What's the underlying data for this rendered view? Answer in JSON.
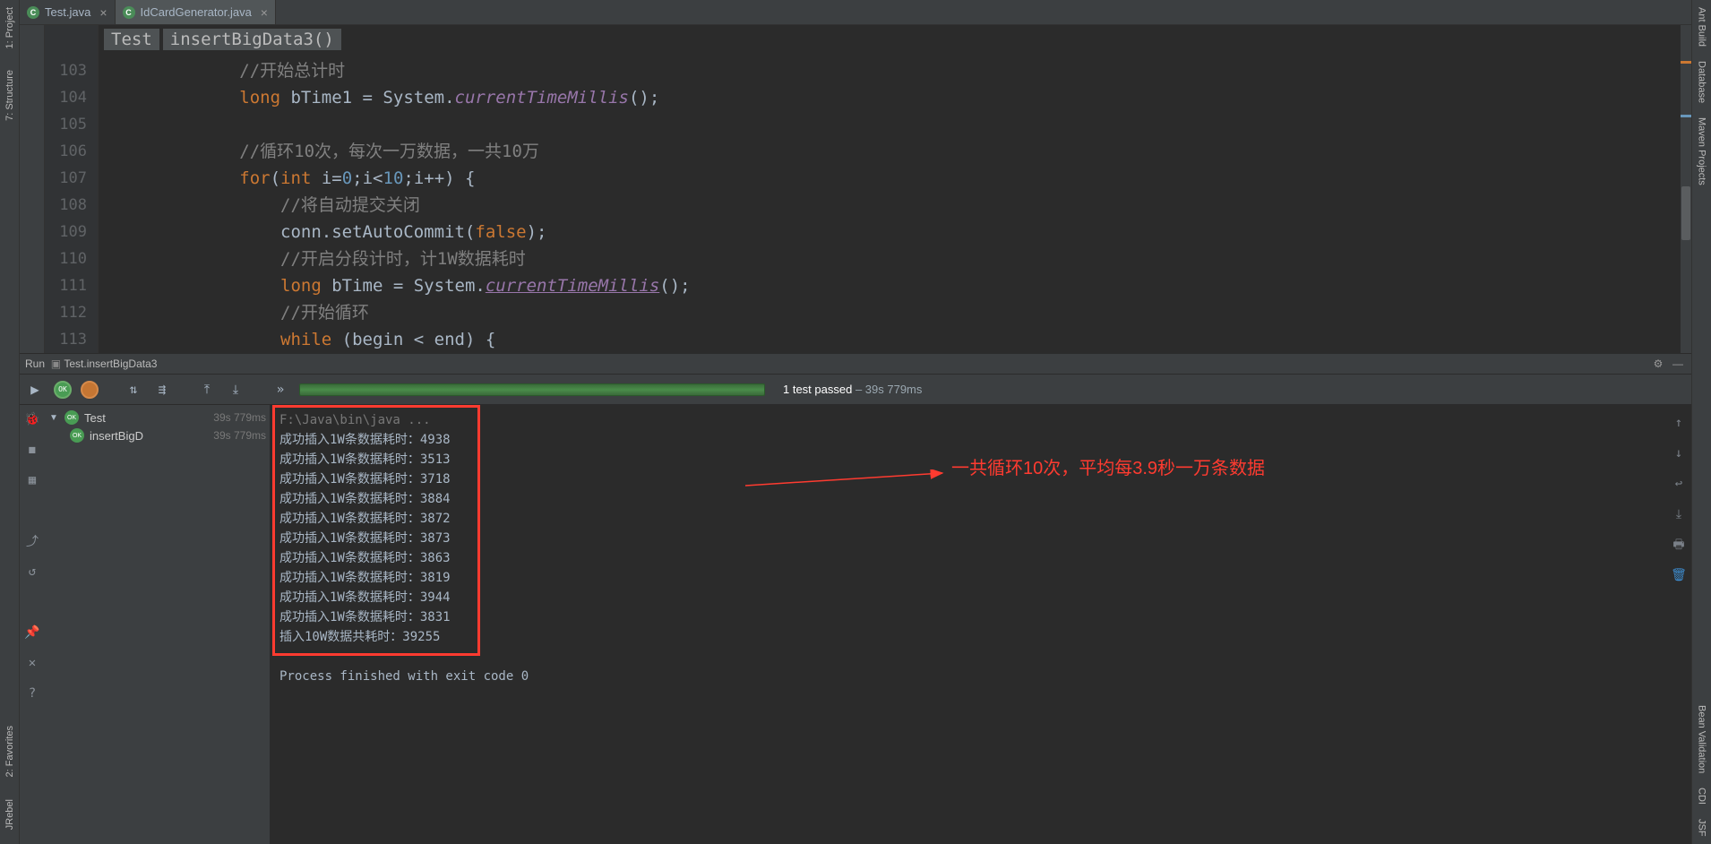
{
  "left_tools": {
    "project": "1: Project",
    "structure": "7: Structure",
    "favorites": "2: Favorites",
    "jrebel": "JRebel"
  },
  "right_tools": {
    "ant": "Ant Build",
    "database": "Database",
    "maven": "Maven Projects",
    "bean": "Bean Validation",
    "cdi": "CDI",
    "jsf": "JSF"
  },
  "tabs": [
    {
      "name": "Test.java",
      "active": false
    },
    {
      "name": "IdCardGenerator.java",
      "active": true
    }
  ],
  "breadcrumb": {
    "class": "Test",
    "method": "insertBigData3()"
  },
  "gutter": [
    "103",
    "104",
    "105",
    "106",
    "107",
    "108",
    "109",
    "110",
    "111",
    "112",
    "113"
  ],
  "code": {
    "l103": "            //开始总计时",
    "l104a": "            ",
    "l104b": "long",
    "l104c": " bTime1 = System.",
    "l104d": "currentTimeMillis",
    "l104e": "();",
    "l105": "",
    "l106": "            //循环10次，每次一万数据，一共10万",
    "l107a": "            ",
    "l107b": "for",
    "l107c": "(",
    "l107d": "int",
    "l107e": " i=",
    "l107f": "0",
    "l107g": ";i<",
    "l107h": "10",
    "l107i": ";i++) {",
    "l108": "                //将自动提交关闭",
    "l109a": "                conn.setAutoCommit(",
    "l109b": "false",
    "l109c": ");",
    "l110": "                //开启分段计时，计1W数据耗时",
    "l111a": "                ",
    "l111b": "long",
    "l111c": " bTime = System.",
    "l111d": "currentTimeMillis",
    "l111e": "();",
    "l112": "                //开始循环",
    "l113a": "                ",
    "l113b": "while",
    "l113c": " (begin < end) {"
  },
  "run": {
    "title": "Run",
    "config": "Test.insertBigData3",
    "summary_passed": "1 test passed",
    "summary_time": "– 39s 779ms"
  },
  "tree": {
    "root_name": "Test",
    "root_time": "39s 779ms",
    "child_name": "insertBigD",
    "child_time": "39s 779ms"
  },
  "console": {
    "cmd": "F:\\Java\\bin\\java ...",
    "lines": [
      "成功插入1W条数据耗时：4938",
      "成功插入1W条数据耗时：3513",
      "成功插入1W条数据耗时：3718",
      "成功插入1W条数据耗时：3884",
      "成功插入1W条数据耗时：3872",
      "成功插入1W条数据耗时：3873",
      "成功插入1W条数据耗时：3863",
      "成功插入1W条数据耗时：3819",
      "成功插入1W条数据耗时：3944",
      "成功插入1W条数据耗时：3831",
      "插入10W数据共耗时：39255"
    ],
    "exit": "Process finished with exit code 0"
  },
  "annotation": "一共循环10次，平均每3.9秒一万条数据"
}
